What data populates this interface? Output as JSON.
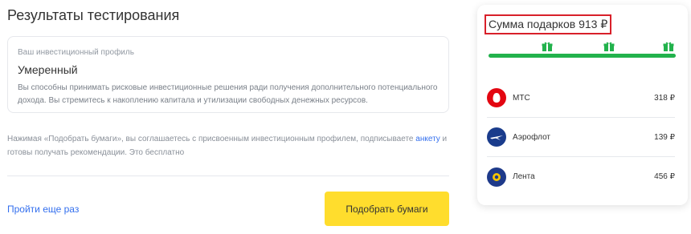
{
  "page": {
    "title": "Результаты тестирования"
  },
  "profile": {
    "label": "Ваш инвестиционный профиль",
    "value": "Умеренный",
    "description": "Вы способны принимать рисковые инвестиционные решения ради получения дополнительного потенциального дохода. Вы стремитесь к накоплению капитала и утилизации свободных денежных ресурсов."
  },
  "consent": {
    "text": "Нажимая «Подобрать бумаги», вы соглашаетесь с присвоенным инвестиционным профилем, подписываете ",
    "link_text": "анкету",
    "text_after": " и готовы получать рекомендации. Это бесплатно"
  },
  "actions": {
    "retry_label": "Пройти еще раз",
    "pick_label": "Подобрать бумаги"
  },
  "gifts": {
    "sum_label": "Сумма подарков 913 ₽",
    "progress_fraction": 1.0,
    "progress_color": "#22b24c",
    "milestone_icon": "gift-icon",
    "items": [
      {
        "name": "МТС",
        "amount": "318 ₽",
        "logo_color": "#e30611",
        "logo_icon": "mts-logo-icon"
      },
      {
        "name": "Аэрофлот",
        "amount": "139 ₽",
        "logo_color": "#1a3c8c",
        "logo_icon": "aeroflot-logo-icon"
      },
      {
        "name": "Лента",
        "amount": "456 ₽",
        "logo_color": "#1e3a8a",
        "logo_icon": "lenta-logo-icon"
      }
    ]
  },
  "colors": {
    "accent_link": "#336fee",
    "button_yellow": "#ffdd2d",
    "highlight_red": "#d8202a"
  }
}
